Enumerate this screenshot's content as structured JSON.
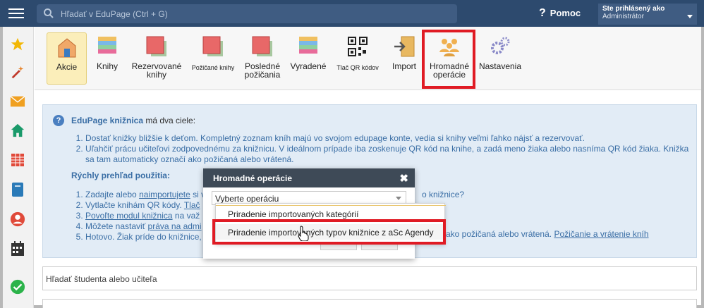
{
  "topbar": {
    "search_placeholder": "Hľadať v EduPage (Ctrl + G)",
    "help_label": "Pomoc",
    "user_line1": "Ste prihlásený ako",
    "user_line2": "Administrátor"
  },
  "sidebar": {
    "items": [
      "star-icon",
      "magic-wand-icon",
      "envelope-icon",
      "home-icon",
      "calendar-grid-icon",
      "book-icon",
      "person-icon",
      "timetable-icon",
      "check-circle-icon"
    ]
  },
  "toolbar": {
    "buttons": [
      {
        "label": "Akcie",
        "icon": "door-icon"
      },
      {
        "label": "Knihy",
        "icon": "books-stack-icon"
      },
      {
        "label": "Rezervované knihy",
        "icon": "reserved-books-icon"
      },
      {
        "label": "Požičané knihy",
        "icon": "borrowed-books-icon"
      },
      {
        "label": "Posledné požičania",
        "icon": "recent-loans-icon"
      },
      {
        "label": "Vyradené",
        "icon": "discarded-books-icon"
      },
      {
        "label": "Tlač QR kódov",
        "icon": "qr-code-icon"
      },
      {
        "label": "Import",
        "icon": "import-icon"
      },
      {
        "label": "Hromadné operácie",
        "icon": "people-group-icon"
      },
      {
        "label": "Nastavenia",
        "icon": "gears-icon"
      }
    ]
  },
  "info": {
    "intro_bold": "EduPage knižnica",
    "intro_rest": " má dva ciele:",
    "goals": [
      "Dostať knižky bližšie k deťom. Kompletný zoznam kníh majú vo svojom edupage konte, vedia si knihy veľmi ľahko nájsť a rezervovať.",
      "Uľahčiť prácu učiteľovi zodpovednému za knižnicu. V ideálnom prípade iba zoskenuje QR kód na knihe, a zadá meno žiaka alebo nasníma QR kód žiaka. Knižka sa tam automaticky označí ako požičaná alebo vrátená."
    ],
    "overview_title": "Rýchly prehľad použitia:",
    "steps": [
      {
        "pre": "Zadajte alebo ",
        "link": "naimportujete",
        "post": " si v"
      },
      {
        "pre": "Vytlačte knihám QR kódy. ",
        "link": "Tlač",
        "post": ""
      },
      {
        "pre": "",
        "link": "Povoľte modul knižnica",
        "post": " na važ"
      },
      {
        "pre": "Môžete nastaviť ",
        "link": "práva na admi",
        "post": ""
      },
      {
        "pre": "Hotovo. Žiak príde do knižnice,",
        "link": "",
        "post": ""
      }
    ],
    "tail_q": "o knižnice?",
    "tail_5_text": "ako požičaná alebo vrátená. ",
    "tail_5_link": "Požičanie a vrátenie kníh"
  },
  "search_row": {
    "label": "Hľadať študenta alebo učiteľa"
  },
  "modal": {
    "title": "Hromadné operácie",
    "close": "✖",
    "select_value": "Vyberte operáciu",
    "options": [
      "Priradenie importovaných kategórií",
      "Priradenie importovaných typov knižnice z aSc Agendy"
    ]
  },
  "colors": {
    "topbar": "#2d4a6e",
    "highlight": "#e01b24",
    "info_bg": "#e2ecf6",
    "link": "#3a6ea5"
  }
}
